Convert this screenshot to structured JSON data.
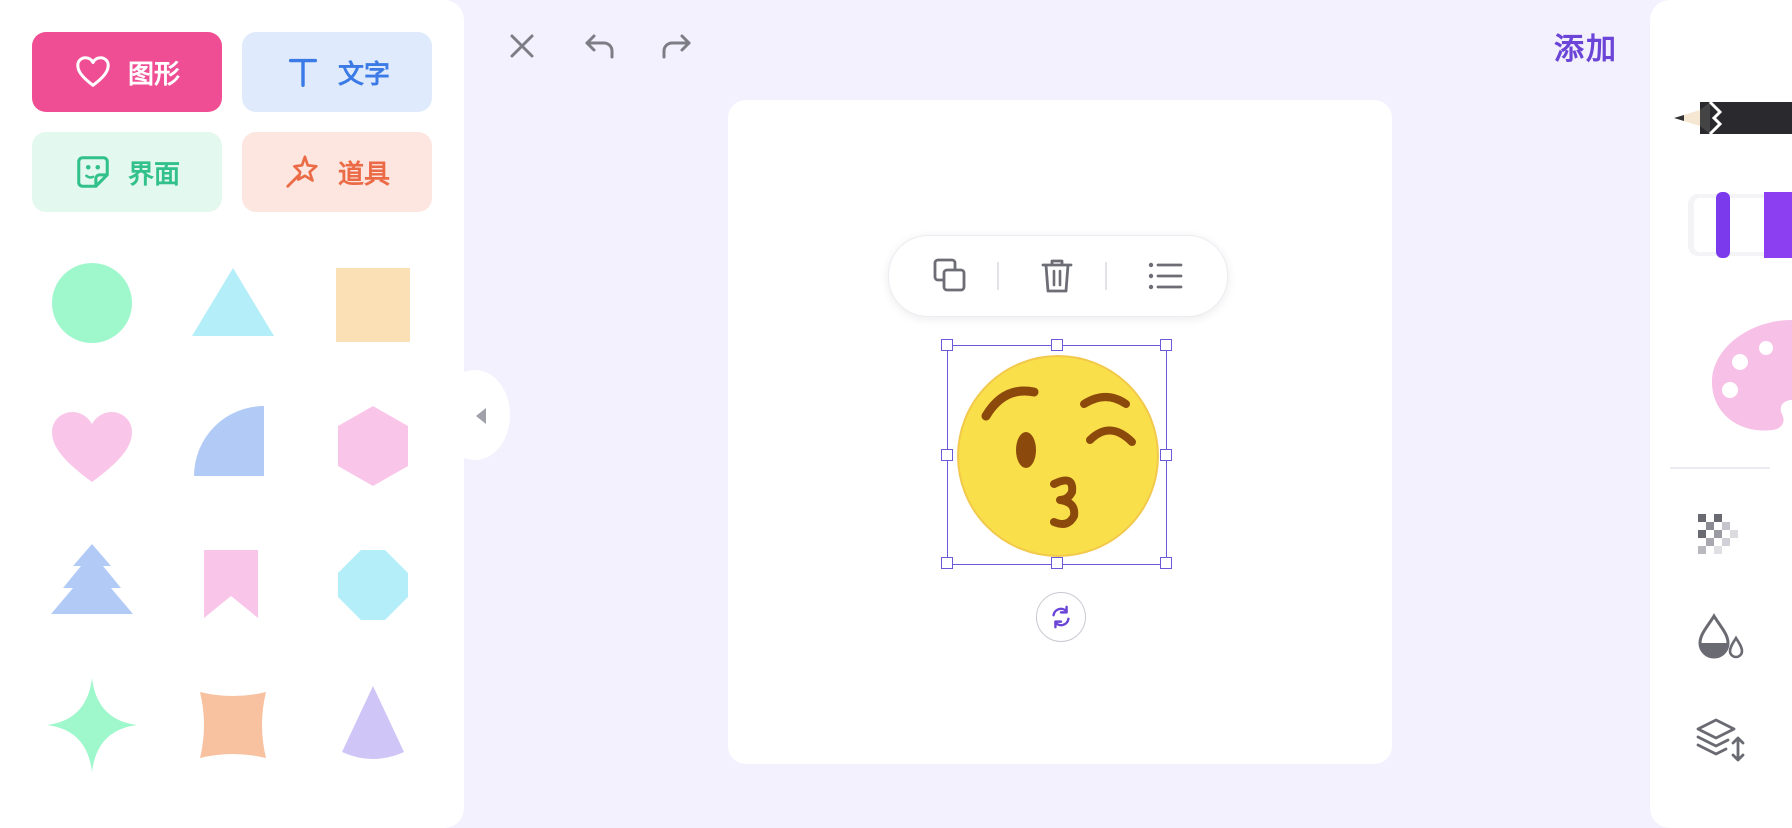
{
  "categories": {
    "shape": "图形",
    "text": "文字",
    "ui": "界面",
    "prop": "道具"
  },
  "toolbar": {
    "add_label": "添加"
  },
  "colors": {
    "accent": "#6b45d8",
    "shape_pink": "#f04e94",
    "text_blue": "#3c7be5",
    "ui_green": "#32c18a",
    "prop_orange": "#ec6b47"
  },
  "shapes": [
    "circle",
    "triangle",
    "square",
    "heart",
    "quarter-circle",
    "hexagon",
    "tree",
    "bookmark",
    "octagon",
    "four-point-star",
    "concave-square",
    "cone"
  ],
  "icons": [
    "close-icon",
    "undo-icon",
    "redo-icon",
    "copy-icon",
    "trash-icon",
    "layer-list-icon",
    "rotate-icon",
    "pencil-icon",
    "marker-icon",
    "palette-icon",
    "transparency-icon",
    "fill-icon",
    "layers-order-icon"
  ]
}
